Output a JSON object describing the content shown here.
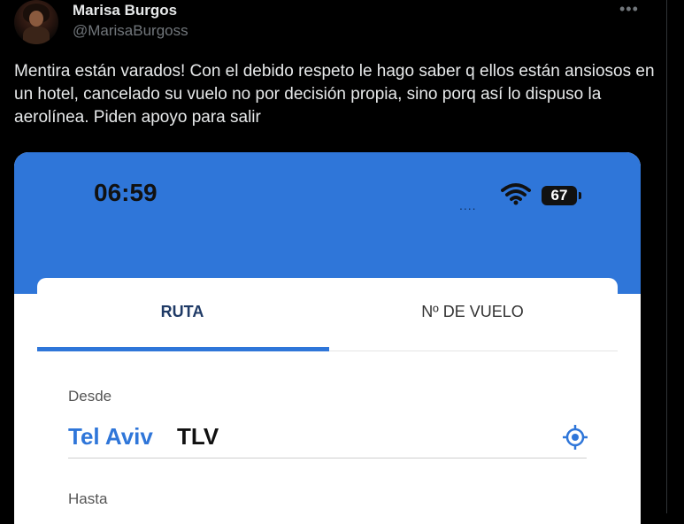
{
  "tweet": {
    "author_name": "Marisa Burgos",
    "handle": "@MarisaBurgoss",
    "more_label": "•••",
    "text": "Mentira están varados! Con el debido respeto le hago saber q ellos están ansiosos en un hotel, cancelado su vuelo no por decisión propia, sino porq así lo dispuso la aerolínea. Piden apoyo para salir"
  },
  "screenshot": {
    "status_bar": {
      "time": "06:59",
      "signal_dots": "....",
      "wifi_icon": "wifi-icon",
      "battery": "67"
    },
    "tabs": [
      {
        "label": "RUTA",
        "active": true
      },
      {
        "label": "Nº DE VUELO",
        "active": false
      }
    ],
    "form": {
      "from_label": "Desde",
      "from_city": "Tel Aviv",
      "from_code": "TLV",
      "locate_icon": "crosshair-icon",
      "to_label": "Hasta"
    },
    "colors": {
      "accent": "#2f76d9",
      "tab_active_text": "#1f3a66"
    }
  }
}
